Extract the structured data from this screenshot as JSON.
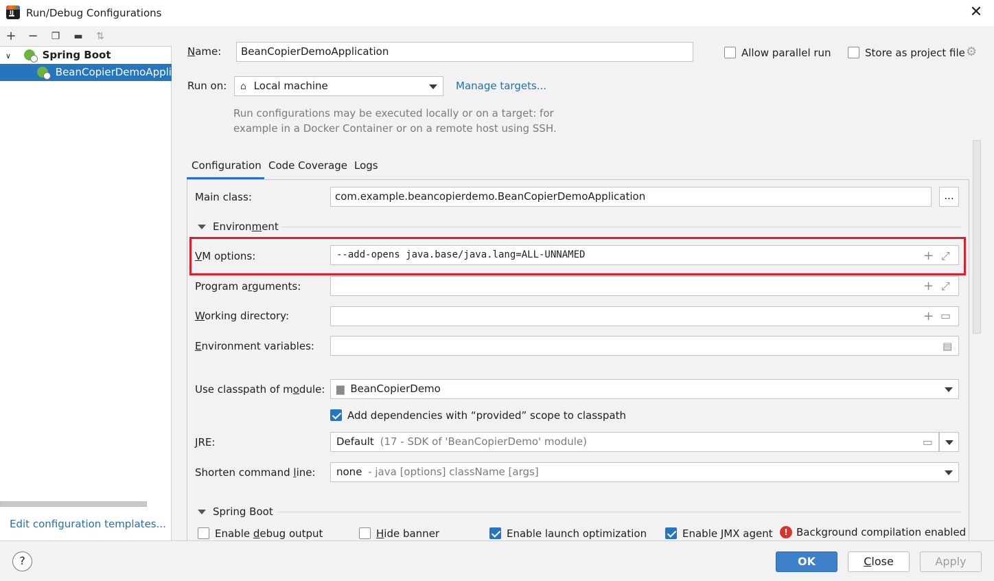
{
  "window": {
    "title": "Run/Debug Configurations"
  },
  "left": {
    "toolbar_icons": [
      "add-icon",
      "remove-icon",
      "copy-icon",
      "move-to-folder-icon",
      "sort-icon"
    ],
    "tree": [
      {
        "label": "Spring Boot"
      },
      {
        "label": "BeanCopierDemoApplication"
      }
    ],
    "edit_templates": "Edit configuration templates..."
  },
  "form": {
    "name_label": "Name:",
    "name_value": "BeanCopierDemoApplication",
    "allow_parallel": "Allow parallel run",
    "store_as_file": "Store as project file",
    "run_on_label": "Run on:",
    "run_on_value": "Local machine",
    "manage_targets": "Manage targets...",
    "run_hint_1": "Run configurations may be executed locally or on a target: for",
    "run_hint_2": "example in a Docker Container or on a remote host using SSH."
  },
  "tabs": [
    "Configuration",
    "Code Coverage",
    "Logs"
  ],
  "config": {
    "main_class_label": "Main class:",
    "main_class_value": "com.example.beancopierdemo.BeanCopierDemoApplication",
    "browse": "...",
    "environment_header": "Environment",
    "vm_options_label": "VM options:",
    "vm_options_value": "--add-opens java.base/java.lang=ALL-UNNAMED",
    "program_args_label": "Program arguments:",
    "working_dir_label": "Working directory:",
    "env_vars_label": "Environment variables:",
    "classpath_label": "Use classpath of module:",
    "classpath_value": "BeanCopierDemo",
    "add_deps": "Add dependencies with “provided” scope to classpath",
    "jre_label": "JRE:",
    "jre_value": "Default",
    "jre_hint": "(17 - SDK of 'BeanCopierDemo' module)",
    "shorten_label": "Shorten command line:",
    "shorten_value": "none",
    "shorten_hint": "- java [options] className [args]",
    "spring_header": "Spring Boot",
    "enable_debug": "Enable debug output",
    "hide_banner": "Hide banner",
    "launch_opt": "Enable launch optimization",
    "jmx_agent": "Enable JMX agent",
    "bg_compile": "Background compilation enabled"
  },
  "buttons": {
    "help": "?",
    "ok": "OK",
    "close": "Close",
    "apply": "Apply"
  }
}
